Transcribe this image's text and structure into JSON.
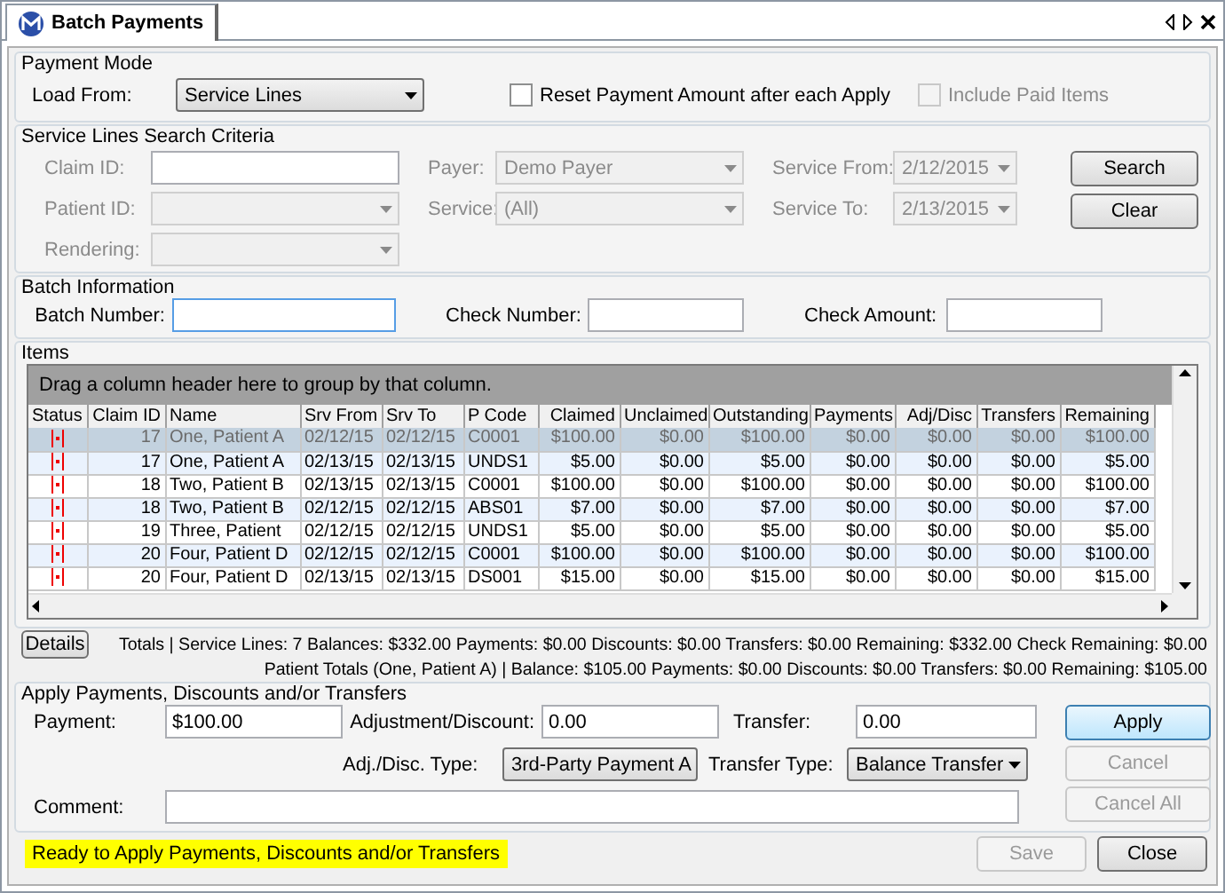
{
  "window": {
    "title": "Batch Payments"
  },
  "payment_mode": {
    "title": "Payment Mode",
    "load_from": {
      "label": "Load From:",
      "value": "Service Lines"
    },
    "options": [
      {
        "label": "Reset Payment Amount after each Apply",
        "checked": false,
        "disabled": false
      },
      {
        "label": "Include Paid Items",
        "checked": false,
        "disabled": true
      }
    ]
  },
  "search_criteria": {
    "title": "Service Lines Search Criteria",
    "columns": [
      [
        {
          "label": "Claim ID:",
          "kind": "input"
        },
        {
          "label": "Patient ID:",
          "kind": "select"
        },
        {
          "label": "Rendering:",
          "kind": "select"
        }
      ],
      [
        {
          "label": "Payer:",
          "kind": "select",
          "value": "Demo Payer"
        },
        {
          "label": "Service:",
          "kind": "select",
          "value": "(All)"
        }
      ],
      [
        {
          "label": "Service From:",
          "kind": "date",
          "value": "2/12/2015"
        },
        {
          "label": "Service To:",
          "kind": "date",
          "value": "2/13/2015"
        }
      ]
    ],
    "buttons": [
      "Search",
      "Clear"
    ]
  },
  "batch_information": {
    "title": "Batch Information",
    "fields": [
      {
        "label": "Batch Number:",
        "focused": true
      },
      {
        "label": "Check Number:",
        "focused": false
      },
      {
        "label": "Check Amount:",
        "focused": false
      }
    ]
  },
  "items": {
    "title": "Items",
    "group_hint": "Drag a column header here to group by that column.",
    "columns": [
      "Status",
      "Claim ID",
      "Name",
      "Srv From",
      "Srv To",
      "P Code",
      "Claimed",
      "Unclaimed",
      "Outstanding",
      "Payments",
      "Adj/Disc",
      "Transfers",
      "Remaining"
    ],
    "rows": [
      {
        "selected": true,
        "cells": [
          "",
          "17",
          "One, Patient A",
          "02/12/15",
          "02/12/15",
          "C0001",
          "$100.00",
          "$0.00",
          "$100.00",
          "$0.00",
          "$0.00",
          "$0.00",
          "$100.00"
        ]
      },
      {
        "selected": false,
        "cells": [
          "",
          "17",
          "One, Patient A",
          "02/13/15",
          "02/13/15",
          "UNDS1",
          "$5.00",
          "$0.00",
          "$5.00",
          "$0.00",
          "$0.00",
          "$0.00",
          "$5.00"
        ]
      },
      {
        "selected": false,
        "cells": [
          "",
          "18",
          "Two, Patient B",
          "02/13/15",
          "02/13/15",
          "C0001",
          "$100.00",
          "$0.00",
          "$100.00",
          "$0.00",
          "$0.00",
          "$0.00",
          "$100.00"
        ]
      },
      {
        "selected": false,
        "cells": [
          "",
          "18",
          "Two, Patient B",
          "02/12/15",
          "02/12/15",
          "ABS01",
          "$7.00",
          "$0.00",
          "$7.00",
          "$0.00",
          "$0.00",
          "$0.00",
          "$7.00"
        ]
      },
      {
        "selected": false,
        "cells": [
          "",
          "19",
          "Three, Patient",
          "02/12/15",
          "02/12/15",
          "UNDS1",
          "$5.00",
          "$0.00",
          "$5.00",
          "$0.00",
          "$0.00",
          "$0.00",
          "$5.00"
        ]
      },
      {
        "selected": false,
        "cells": [
          "",
          "20",
          "Four, Patient D",
          "02/12/15",
          "02/12/15",
          "C0001",
          "$100.00",
          "$0.00",
          "$100.00",
          "$0.00",
          "$0.00",
          "$0.00",
          "$100.00"
        ]
      },
      {
        "selected": false,
        "cells": [
          "",
          "20",
          "Four, Patient D",
          "02/13/15",
          "02/13/15",
          "DS001",
          "$15.00",
          "$0.00",
          "$15.00",
          "$0.00",
          "$0.00",
          "$0.00",
          "$15.00"
        ]
      }
    ]
  },
  "details_button": "Details",
  "totals": "Totals | Service Lines: 7 Balances: $332.00 Payments: $0.00 Discounts: $0.00 Transfers: $0.00 Remaining: $332.00 Check Remaining: $0.00",
  "patient_totals": "Patient Totals (One, Patient A) |  Balance: $105.00 Payments: $0.00 Discounts: $0.00 Transfers: $0.00 Remaining: $105.00",
  "apply": {
    "title": "Apply Payments, Discounts and/or Transfers",
    "payment": {
      "label": "Payment:",
      "value": "$100.00"
    },
    "adjustment": {
      "label": "Adjustment/Discount:",
      "value": "0.00"
    },
    "transfer": {
      "label": "Transfer:",
      "value": "0.00"
    },
    "adj_type": {
      "label": "Adj./Disc. Type:",
      "value": "3rd-Party Payment A"
    },
    "transfer_type": {
      "label": "Transfer Type:",
      "value": "Balance Transfer"
    },
    "comment": {
      "label": "Comment:"
    },
    "buttons": [
      {
        "label": "Apply",
        "disabled": false,
        "default": true
      },
      {
        "label": "Cancel",
        "disabled": true,
        "default": false
      },
      {
        "label": "Cancel All",
        "disabled": true,
        "default": false
      }
    ]
  },
  "status_bar": {
    "message": "Ready to Apply Payments, Discounts and/or Transfers",
    "buttons": [
      {
        "label": "Save",
        "disabled": true
      },
      {
        "label": "Close",
        "disabled": false
      }
    ]
  }
}
